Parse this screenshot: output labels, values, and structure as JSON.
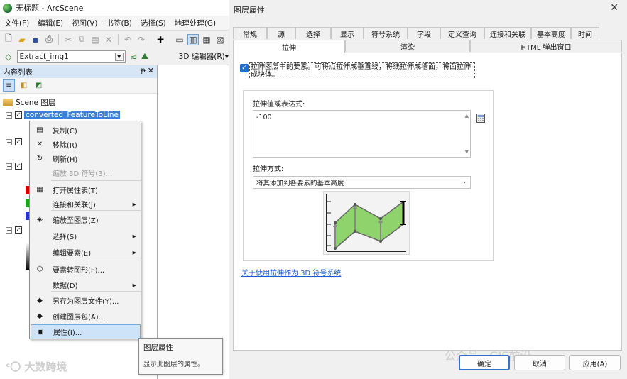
{
  "app": {
    "title": "无标题 - ArcScene",
    "menu": [
      "文件(F)",
      "编辑(E)",
      "视图(V)",
      "书签(B)",
      "选择(S)",
      "地理处理(G)"
    ],
    "layer_dropdown": "Extract_img1",
    "editor_3d": "3D 编辑器(R)▾"
  },
  "toc": {
    "title": "内容列表",
    "pin_glyph": "ᵽ",
    "close_glyph": "✕",
    "root": "Scene 图层",
    "selected_layer": "converted_FeatureToLine",
    "swatch_colors": [
      "#d40000",
      "#1ba41b",
      "#2233cc"
    ]
  },
  "context_menu": {
    "items": [
      {
        "label": "复制(C)",
        "icon": "copy-icon",
        "glyph": "▤",
        "submenu": false,
        "disabled": false
      },
      {
        "label": "移除(R)",
        "icon": "remove-icon",
        "glyph": "✕",
        "submenu": false,
        "disabled": false
      },
      {
        "label": "刷新(H)",
        "icon": "refresh-icon",
        "glyph": "↻",
        "submenu": false,
        "disabled": false
      },
      {
        "label": "缩放 3D 符号(3)...",
        "icon": "",
        "glyph": "",
        "submenu": false,
        "disabled": true
      },
      {
        "label": "打开属性表(T)",
        "icon": "table-icon",
        "glyph": "▦",
        "submenu": false,
        "disabled": false
      },
      {
        "label": "连接和关联(J)",
        "icon": "",
        "glyph": "",
        "submenu": true,
        "disabled": false
      },
      {
        "label": "缩放至图层(Z)",
        "icon": "zoom-layer-icon",
        "glyph": "◈",
        "submenu": false,
        "disabled": false
      },
      {
        "label": "选择(S)",
        "icon": "",
        "glyph": "",
        "submenu": true,
        "disabled": false
      },
      {
        "label": "编辑要素(E)",
        "icon": "",
        "glyph": "",
        "submenu": true,
        "disabled": false
      },
      {
        "label": "要素转图形(F)...",
        "icon": "feature-graphic-icon",
        "glyph": "⬡",
        "submenu": false,
        "disabled": false
      },
      {
        "label": "数据(D)",
        "icon": "",
        "glyph": "",
        "submenu": true,
        "disabled": false
      },
      {
        "label": "另存为图层文件(Y)...",
        "icon": "layer-file-icon",
        "glyph": "◆",
        "submenu": false,
        "disabled": false
      },
      {
        "label": "创建图层包(A)...",
        "icon": "layer-package-icon",
        "glyph": "◆",
        "submenu": false,
        "disabled": false
      },
      {
        "label": "属性(I)...",
        "icon": "properties-icon",
        "glyph": "▣",
        "submenu": false,
        "disabled": false
      }
    ],
    "submenu_glyph": "▶"
  },
  "tooltip": {
    "title": "图层属性",
    "body": "显示此图层的属性。"
  },
  "dialog": {
    "title": "图层属性",
    "close_glyph": "✕",
    "tabs_row1": [
      "常规",
      "源",
      "选择",
      "显示",
      "符号系统",
      "字段",
      "定义查询",
      "连接和关联",
      "基本高度",
      "时间"
    ],
    "tabs_row2": [
      "拉伸",
      "渲染",
      "HTML 弹出窗口"
    ],
    "active_tab": "拉伸",
    "extrude_checkbox": "拉伸图层中的要素。可将点拉伸成垂直线，将线拉伸成墙面，将面拉伸成块体。",
    "expression_label": "拉伸值或表达式:",
    "expression_value": "-100",
    "method_label": "拉伸方式:",
    "method_value": "将其添加到各要素的基本高度",
    "help_link": "关于使用拉伸作为 3D 符号系统",
    "buttons": {
      "ok": "确定",
      "cancel": "取消",
      "apply": "应用(A)"
    },
    "watermark": "公众号 · GIS前沿"
  }
}
